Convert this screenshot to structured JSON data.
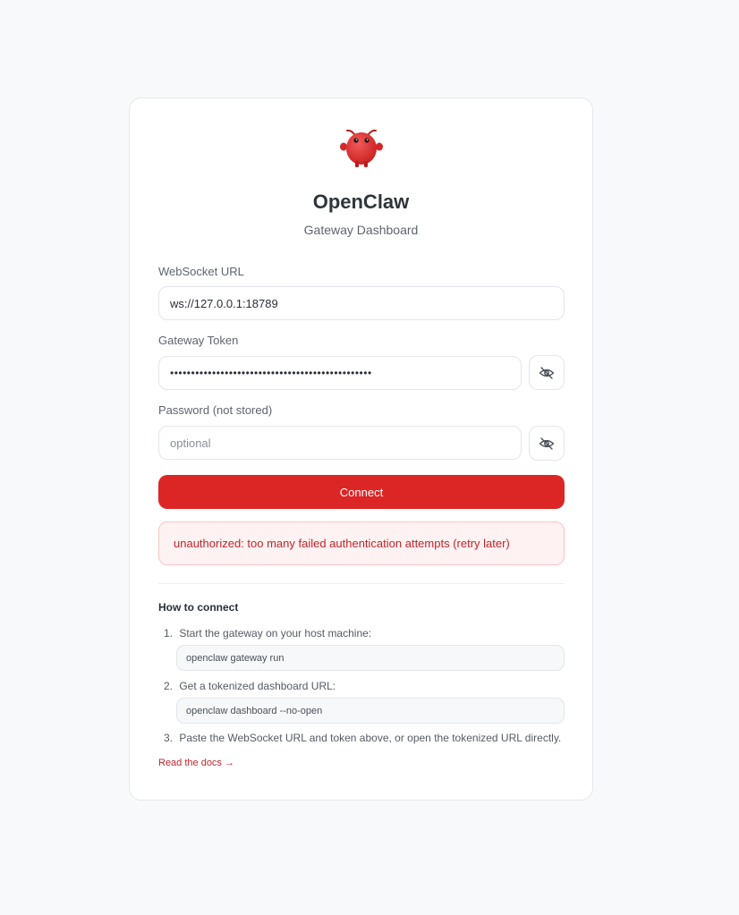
{
  "brand": {
    "title": "OpenClaw",
    "subtitle": "Gateway Dashboard",
    "accent": "#dc2626"
  },
  "form": {
    "websocket_label": "WebSocket URL",
    "websocket_value": "ws://127.0.0.1:18789",
    "token_label": "Gateway Token",
    "token_value": "••••••••••••••••••••••••••••••••••••••••••••••••",
    "password_label": "Password (not stored)",
    "password_placeholder": "optional",
    "toggle_icon": "eye-off-icon",
    "connect_label": "Connect"
  },
  "error": {
    "message": "unauthorized: too many failed authentication attempts (retry later)"
  },
  "help": {
    "title": "How to connect",
    "steps": [
      {
        "num": "1.",
        "text": "Start the gateway on your host machine:",
        "code": "openclaw gateway run"
      },
      {
        "num": "2.",
        "text": "Get a tokenized dashboard URL:",
        "code": "openclaw dashboard --no-open"
      },
      {
        "num": "3.",
        "text": "Paste the WebSocket URL and token above, or open the tokenized URL directly."
      }
    ],
    "docs_link": "Read the docs →"
  }
}
